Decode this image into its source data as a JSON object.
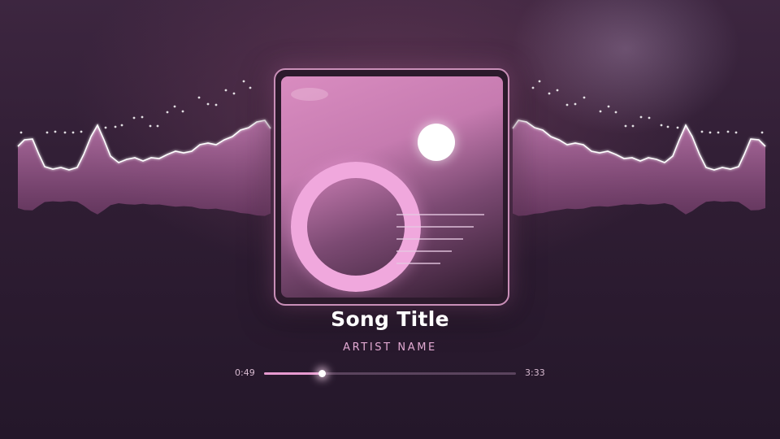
{
  "song": {
    "title": "Song Title",
    "artist": "ARTIST NAME"
  },
  "playback": {
    "current_time": "0:49",
    "total_time": "3:33",
    "progress_fraction": 0.23
  },
  "colors": {
    "accent": "#e79ad0",
    "waveform_fill": "#b56aa3",
    "waveform_line": "#ffffff"
  },
  "icons": {
    "album_art": "album-cover-art"
  }
}
